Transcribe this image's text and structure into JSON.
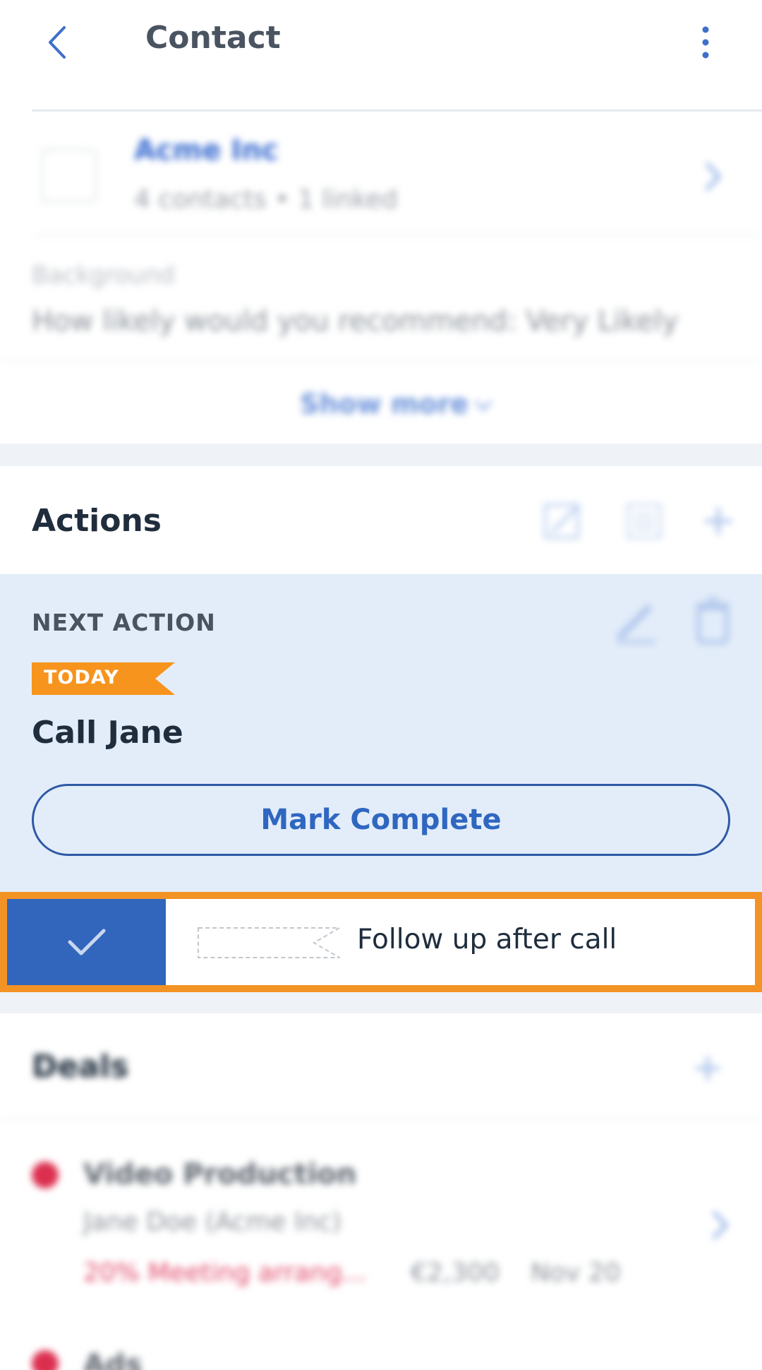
{
  "header": {
    "title": "Contact"
  },
  "company": {
    "name": "Acme Inc",
    "subtitle": "4 contacts • 1 linked"
  },
  "background": {
    "label": "Background",
    "text": "How likely would you recommend: Very Likely"
  },
  "show_more": {
    "label": "Show more"
  },
  "actions": {
    "title": "Actions",
    "next_action": {
      "label": "NEXT ACTION",
      "badge": "TODAY",
      "title": "Call Jane",
      "mark_complete": "Mark Complete"
    },
    "completed_item": {
      "text": "Follow up after call"
    }
  },
  "deals": {
    "title": "Deals",
    "items": [
      {
        "name": "Video Production",
        "contact": "Jane Doe (Acme Inc)",
        "stage": "20% Meeting arrang...",
        "amount": "€2,300",
        "date": "Nov 20"
      },
      {
        "name": "Ads"
      }
    ]
  },
  "colors": {
    "accent_blue": "#3166bc",
    "highlight_orange": "#f39325",
    "badge_orange": "#f7941d",
    "deal_red": "#dc2f4f"
  }
}
